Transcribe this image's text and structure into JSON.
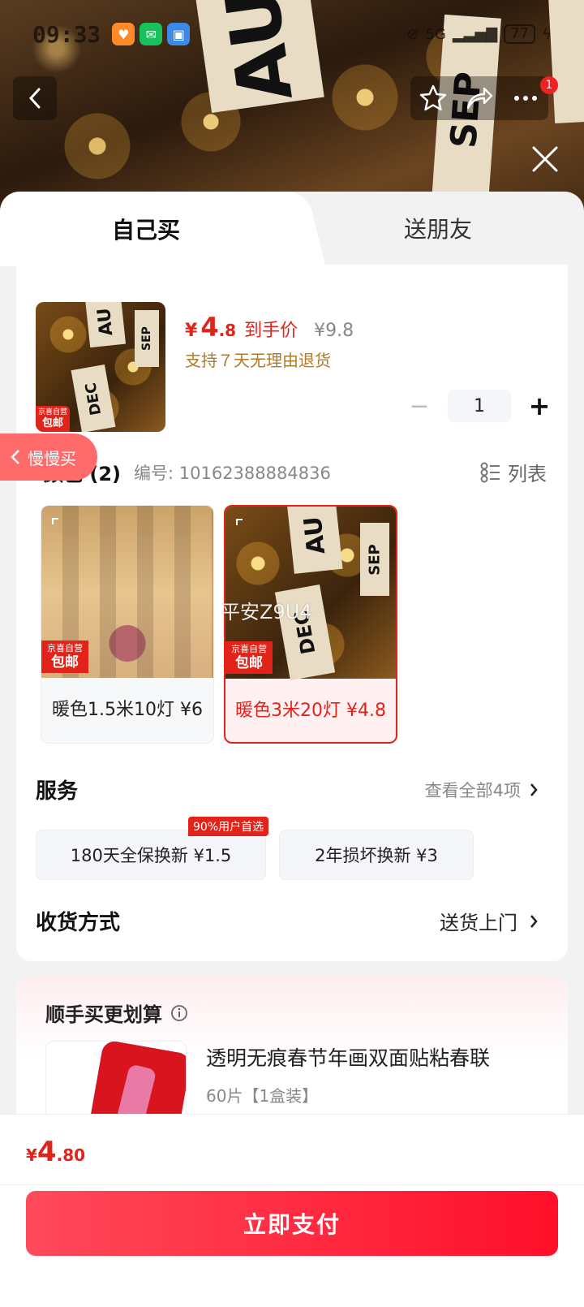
{
  "status_bar": {
    "time": "09:33",
    "network": "5G",
    "battery": "77"
  },
  "top_nav": {
    "notification_count": "1"
  },
  "hero_image": {
    "letters_1": "AU",
    "letters_2": "SEP"
  },
  "tabs": [
    {
      "label": "自己买",
      "active": true
    },
    {
      "label": "送朋友",
      "active": false
    }
  ],
  "product": {
    "thumb_tag_top": "京喜自营",
    "thumb_tag_bottom": "包邮",
    "thumb_letters_1": "AU",
    "thumb_letters_2": "DEC",
    "thumb_letters_3": "SEP",
    "price_currency": "¥",
    "price_int": "4",
    "price_dec": ".8",
    "price_label": "到手价",
    "original_price": "¥9.8",
    "return_note": "支持７天无理由退货",
    "quantity": "1"
  },
  "floating_tab": {
    "label": "慢慢买"
  },
  "color_section": {
    "title": "颜色 (2)",
    "sku": "编号: 10162388884836",
    "list_label": "列表"
  },
  "options": [
    {
      "label": "暖色1.5米10灯  ¥6",
      "tag_top": "京喜自营",
      "tag_bottom": "包邮",
      "selected": false
    },
    {
      "label": "暖色3米20灯 ¥4.8",
      "tag_top": "京喜自营",
      "tag_bottom": "包邮",
      "selected": true
    }
  ],
  "watermark": "平安Z9U4",
  "services": {
    "title": "服务",
    "more": "查看全部4项",
    "badge": "90%用户首选",
    "chips": [
      {
        "label": "180天全保换新  ¥1.5"
      },
      {
        "label": "2年损坏换新  ¥3"
      }
    ]
  },
  "shipping": {
    "title": "收货方式",
    "value": "送货上门"
  },
  "upsell": {
    "title": "顺手买更划算",
    "product_name": "透明无痕春节年画双面贴粘春联",
    "product_spec": "60片【1盒装】"
  },
  "bottom": {
    "total_currency": "¥",
    "total_int": "4",
    "total_dec": ".80",
    "pay_label": "立即支付"
  },
  "colors": {
    "accent": "#e2231a",
    "pay_button": "#ff1f35",
    "gold_text": "#b07a26"
  }
}
